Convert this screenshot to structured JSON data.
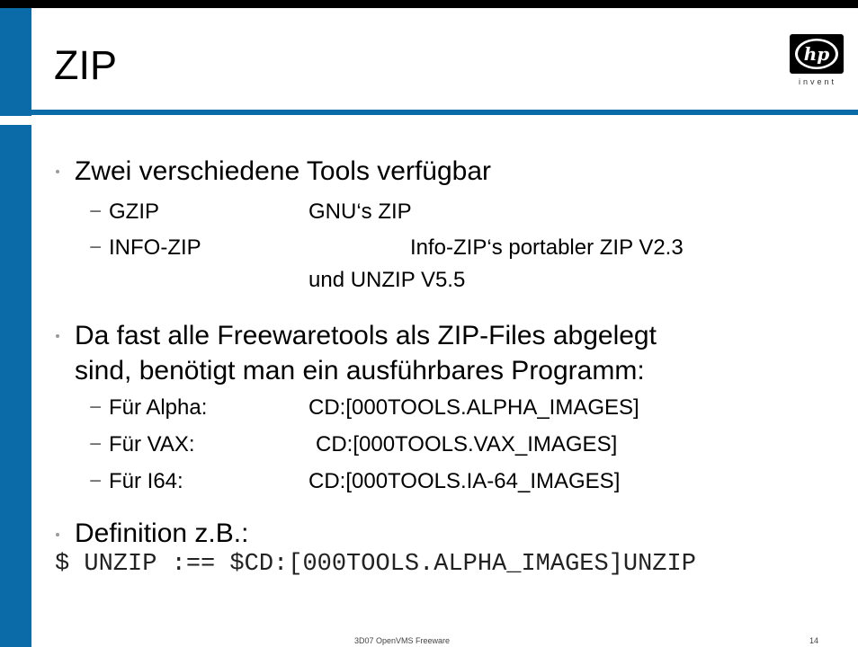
{
  "slide": {
    "title": "ZIP",
    "logo_text": "invent",
    "bullets": [
      {
        "text": "Zwei verschiedene Tools verfügbar",
        "items": [
          {
            "label": "GZIP",
            "value": "GNU‘s ZIP"
          },
          {
            "label": "INFO-ZIP",
            "value": "Info-ZIP‘s portabler ZIP V2.3",
            "value_cont": "und UNZIP V5.5"
          }
        ]
      },
      {
        "line1": "Da fast alle Freewaretools als ZIP-Files abgelegt",
        "line2": "sind, benötigt man ein ausführbares Programm:",
        "items": [
          {
            "label": "Für Alpha:",
            "value": "CD:[000TOOLS.ALPHA_IMAGES]"
          },
          {
            "label": "Für VAX:",
            "value": "CD:[000TOOLS.VAX_IMAGES]"
          },
          {
            "label": "Für I64:",
            "value": "CD:[000TOOLS.IA-64_IMAGES]"
          }
        ]
      },
      {
        "text": "Definition z.B.:",
        "code": "$ UNZIP :== $CD:[000TOOLS.ALPHA_IMAGES]UNZIP"
      }
    ],
    "footer_center": "3D07  OpenVMS Freeware",
    "page_number": "14"
  },
  "colors": {
    "accent": "#0b6ba9",
    "frame": "#000000"
  },
  "icons": {
    "logo": "hp-logo"
  }
}
